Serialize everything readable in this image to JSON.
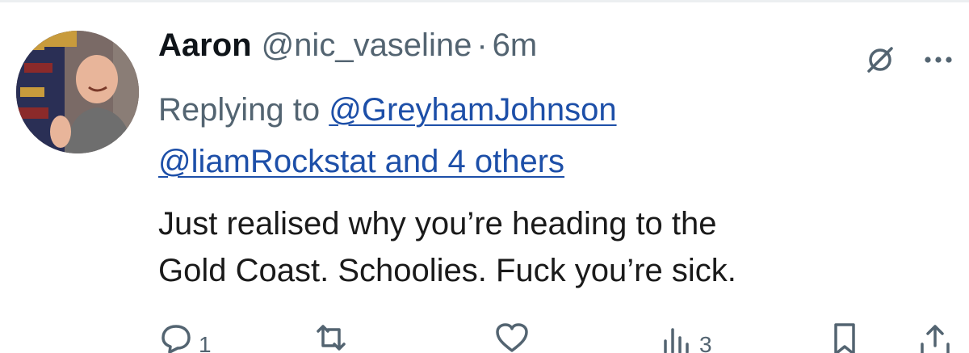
{
  "tweet": {
    "display_name": "Aaron",
    "handle": "@nic_vaseline",
    "separator": "·",
    "time": "6m",
    "replying_prefix": "Replying to ",
    "reply_mention_1": "@GreyhamJohnson",
    "reply_mention_2": "@liamRockstat and 4 others",
    "text_line_1": "Just realised why you’re heading to the",
    "text_line_2": "Gold Coast. Schoolies. Fuck you’re sick."
  },
  "actions": {
    "reply_count": "1",
    "retweet_count": "",
    "like_count": "",
    "views_count": "3"
  },
  "icons": {
    "top": [
      "grok-icon",
      "more-icon"
    ],
    "bar": [
      "reply-icon",
      "retweet-icon",
      "like-icon",
      "views-icon",
      "bookmark-icon",
      "share-icon"
    ]
  },
  "colors": {
    "link": "#1d4fa8",
    "secondary_text": "#536471",
    "primary_text": "#0f1419"
  }
}
